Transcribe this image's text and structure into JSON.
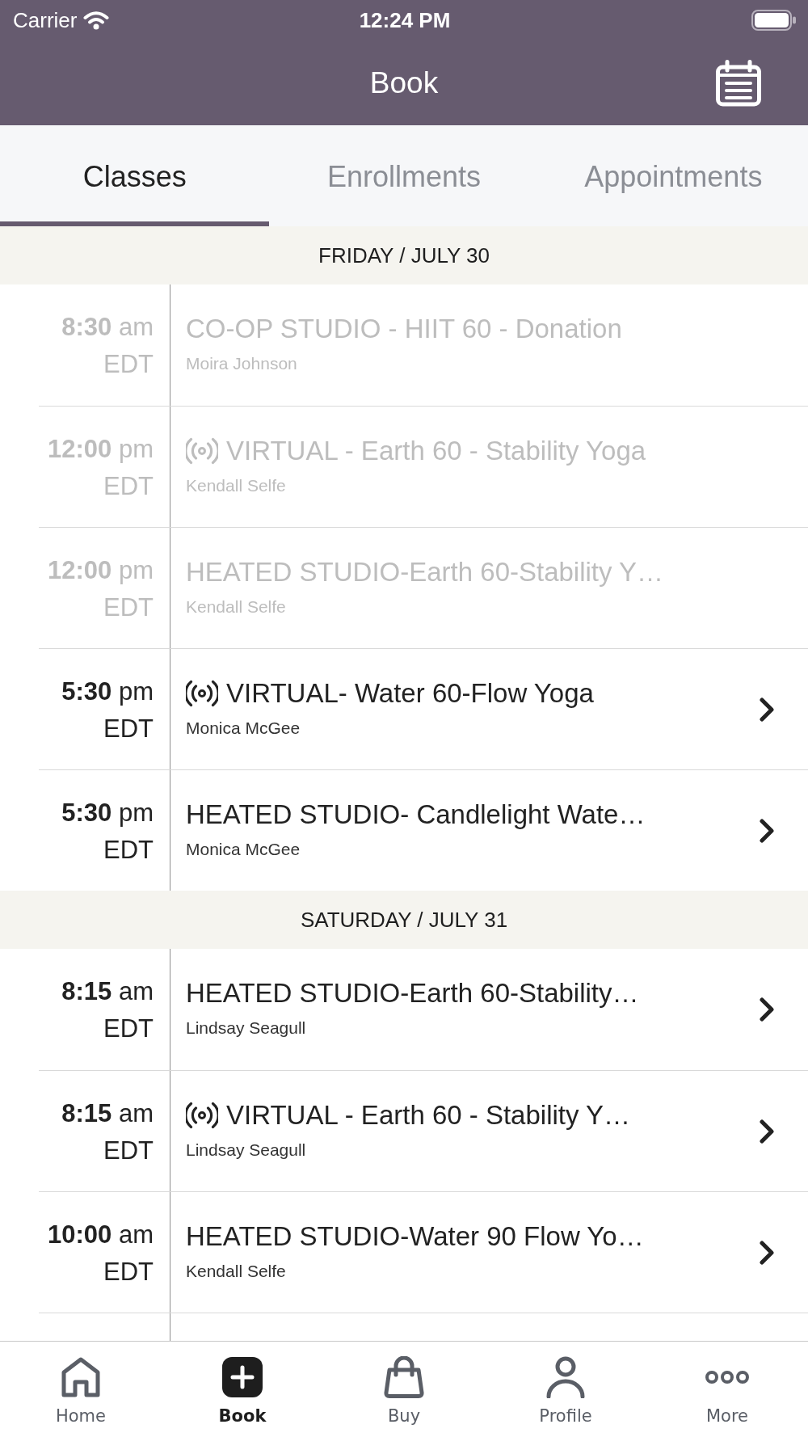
{
  "status_bar": {
    "carrier": "Carrier",
    "time": "12:24 PM"
  },
  "header": {
    "title": "Book"
  },
  "tabs": [
    {
      "label": "Classes",
      "selected": true
    },
    {
      "label": "Enrollments",
      "selected": false
    },
    {
      "label": "Appointments",
      "selected": false
    }
  ],
  "days": [
    {
      "heading": "FRIDAY / JULY 30",
      "classes": [
        {
          "time": "**8:30** am",
          "zone": "EDT",
          "title": "CO-OP STUDIO - HIIT 60 - Donation",
          "instructor": "Moira Johnson",
          "virtual": false,
          "disabled": true
        },
        {
          "time": "**12:00** pm",
          "zone": "EDT",
          "title": "VIRTUAL - Earth 60 - Stability Yoga",
          "instructor": "Kendall Selfe",
          "virtual": true,
          "disabled": true
        },
        {
          "time": "**12:00** pm",
          "zone": "EDT",
          "title": "HEATED STUDIO-Earth 60-Stability Y…",
          "instructor": "Kendall Selfe",
          "virtual": false,
          "disabled": true
        },
        {
          "time": "**5:30** pm",
          "zone": "EDT",
          "title": "VIRTUAL- Water 60-Flow Yoga",
          "instructor": "Monica McGee",
          "virtual": true,
          "disabled": false
        },
        {
          "time": "**5:30** pm",
          "zone": "EDT",
          "title": "HEATED STUDIO- Candlelight Wate…",
          "instructor": "Monica McGee",
          "virtual": false,
          "disabled": false
        }
      ]
    },
    {
      "heading": "SATURDAY / JULY 31",
      "classes": [
        {
          "time": "**8:15** am",
          "zone": "EDT",
          "title": "HEATED STUDIO-Earth 60-Stability…",
          "instructor": "Lindsay Seagull",
          "virtual": false,
          "disabled": false
        },
        {
          "time": "**8:15** am",
          "zone": "EDT",
          "title": "VIRTUAL - Earth 60 - Stability Y…",
          "instructor": "Lindsay Seagull",
          "virtual": true,
          "disabled": false
        },
        {
          "time": "**10:00** am",
          "zone": "EDT",
          "title": "HEATED STUDIO-Water 90 Flow Yo…",
          "instructor": "Kendall Selfe",
          "virtual": false,
          "disabled": false
        }
      ]
    }
  ],
  "bottom_nav": [
    {
      "label": "Home",
      "selected": false
    },
    {
      "label": "Book",
      "selected": true
    },
    {
      "label": "Buy",
      "selected": false
    },
    {
      "label": "Profile",
      "selected": false
    },
    {
      "label": "More",
      "selected": false
    }
  ]
}
